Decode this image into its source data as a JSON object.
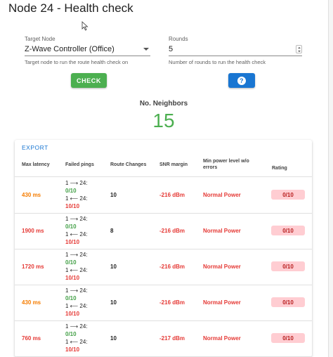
{
  "dialog": {
    "title": "Node 24 - Health check"
  },
  "form": {
    "target_node": {
      "label": "Target Node",
      "value": "Z-Wave Controller (Office)",
      "hint": "Target node to run the route health check on"
    },
    "rounds": {
      "label": "Rounds",
      "value": "5",
      "hint": "Number of rounds to run the health check"
    }
  },
  "actions": {
    "check_label": "CHECK",
    "help_symbol": "?"
  },
  "neighbors": {
    "label": "No. Neighbors",
    "value": "15"
  },
  "table": {
    "export_label": "EXPORT",
    "headers": {
      "max_latency": "Max latency",
      "failed_pings": "Failed pings",
      "route_changes": "Route Changes",
      "snr_margin": "SNR margin",
      "min_power_line1": "Min power level w/o",
      "min_power_line2": "errors",
      "rating": "Rating"
    },
    "rows": [
      {
        "max_latency": "430 ms",
        "latency_level": "warn",
        "ping_out_label": "1 ⟶ 24:",
        "ping_out": "0/10",
        "ping_in_label": "1 ⟵ 24:",
        "ping_in": "10/10",
        "route_changes": "10",
        "snr_margin": "-216 dBm",
        "min_power": "Normal Power",
        "rating": "0/10"
      },
      {
        "max_latency": "1900 ms",
        "latency_level": "bad",
        "ping_out_label": "1 ⟶ 24:",
        "ping_out": "0/10",
        "ping_in_label": "1 ⟵ 24:",
        "ping_in": "10/10",
        "route_changes": "8",
        "snr_margin": "-216 dBm",
        "min_power": "Normal Power",
        "rating": "0/10"
      },
      {
        "max_latency": "1720 ms",
        "latency_level": "bad",
        "ping_out_label": "1 ⟶ 24:",
        "ping_out": "0/10",
        "ping_in_label": "1 ⟵ 24:",
        "ping_in": "10/10",
        "route_changes": "10",
        "snr_margin": "-216 dBm",
        "min_power": "Normal Power",
        "rating": "0/10"
      },
      {
        "max_latency": "430 ms",
        "latency_level": "warn",
        "ping_out_label": "1 ⟶ 24:",
        "ping_out": "0/10",
        "ping_in_label": "1 ⟵ 24:",
        "ping_in": "10/10",
        "route_changes": "10",
        "snr_margin": "-216 dBm",
        "min_power": "Normal Power",
        "rating": "0/10"
      },
      {
        "max_latency": "760 ms",
        "latency_level": "bad",
        "ping_out_label": "1 ⟶ 24:",
        "ping_out": "0/10",
        "ping_in_label": "1 ⟵ 24:",
        "ping_in": "10/10",
        "route_changes": "10",
        "snr_margin": "-217 dBm",
        "min_power": "Normal Power",
        "rating": "0/10"
      }
    ]
  },
  "colors": {
    "success": "#4caf50",
    "primary": "#1976d2",
    "error": "#e53935",
    "warning": "#f57c00",
    "rating_bg": "#ffcdd2"
  },
  "icons": {
    "cursor": "mouse-pointer-icon",
    "dropdown": "chevron-down-icon",
    "stepper": "number-stepper-icon",
    "help": "help-circle-icon"
  }
}
